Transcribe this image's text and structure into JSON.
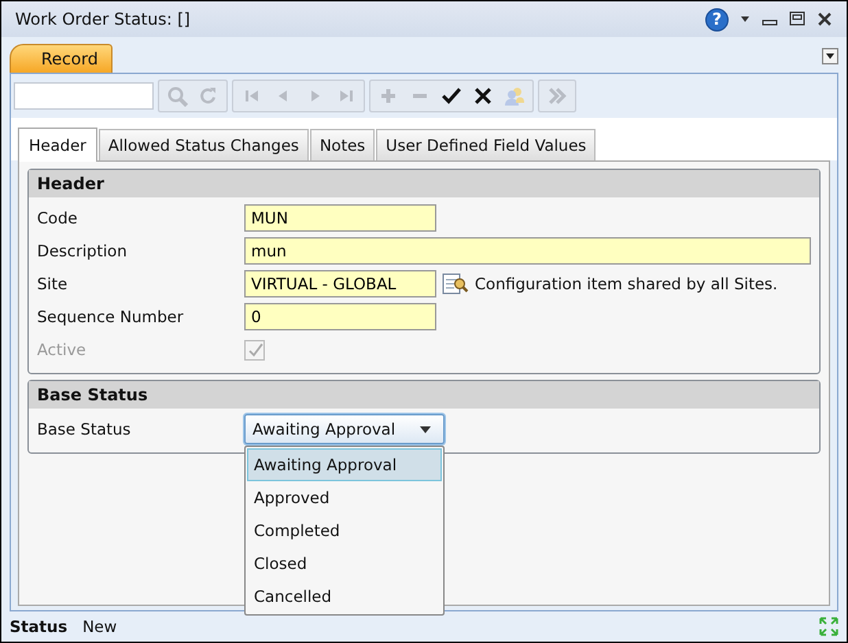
{
  "window": {
    "title": "Work Order Status: []",
    "help_button": {
      "label": "?"
    }
  },
  "ribbon_tabs": [
    {
      "label": "Record",
      "selected": true
    }
  ],
  "toolbar": {
    "groups": [
      [
        {
          "kind": "search",
          "disabled": true
        },
        {
          "kind": "refresh",
          "disabled": true
        }
      ],
      [
        {
          "kind": "first",
          "disabled": true
        },
        {
          "kind": "prev",
          "disabled": true
        },
        {
          "kind": "next",
          "disabled": true
        },
        {
          "kind": "last",
          "disabled": true
        }
      ],
      [
        {
          "kind": "add",
          "disabled": true
        },
        {
          "kind": "remove",
          "disabled": true
        },
        {
          "kind": "save",
          "disabled": false
        },
        {
          "kind": "cancel",
          "disabled": false
        },
        {
          "kind": "users",
          "disabled": true
        }
      ],
      [
        {
          "kind": "more",
          "disabled": true
        }
      ]
    ]
  },
  "tabs": [
    {
      "label": "Header",
      "selected": true
    },
    {
      "label": "Allowed Status Changes",
      "selected": false
    },
    {
      "label": "Notes",
      "selected": false
    },
    {
      "label": "User Defined Field Values",
      "selected": false
    }
  ],
  "header_section": {
    "title": "Header",
    "fields": [
      {
        "kind": "text",
        "label": "Code",
        "value": "MUN",
        "wide": false
      },
      {
        "kind": "text",
        "label": "Description",
        "value": "mun",
        "wide": true
      },
      {
        "kind": "text",
        "label": "Site",
        "value": "VIRTUAL - GLOBAL",
        "wide": false,
        "note": "Configuration item shared by all Sites."
      },
      {
        "kind": "text",
        "label": "Sequence Number",
        "value": "0",
        "wide": false
      },
      {
        "kind": "checkbox",
        "label": "Active",
        "checked": true,
        "disabled": true
      }
    ]
  },
  "base_status_section": {
    "title": "Base Status",
    "label": "Base Status",
    "dropdown": {
      "value": "Awaiting Approval",
      "expanded": true,
      "options": [
        {
          "label": "Awaiting Approval",
          "selected": true
        },
        {
          "label": "Approved",
          "selected": false
        },
        {
          "label": "Completed",
          "selected": false
        },
        {
          "label": "Closed",
          "selected": false
        },
        {
          "label": "Cancelled",
          "selected": false
        }
      ]
    }
  },
  "status_bar": {
    "label": "Status",
    "value": "New"
  }
}
